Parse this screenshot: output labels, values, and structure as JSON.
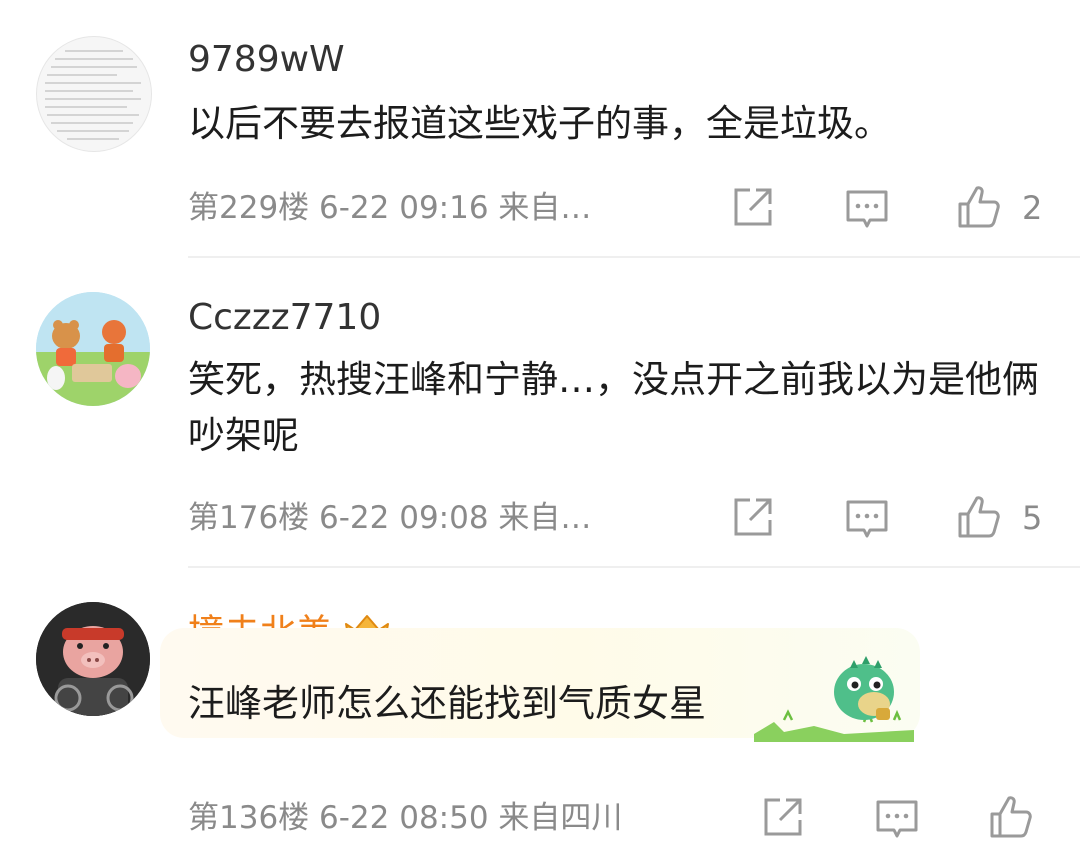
{
  "comments": [
    {
      "username": "9789wW",
      "text": "以后不要去报道这些戏子的事，全是垃圾。",
      "meta": "第229楼  6-22 09:16  来自…",
      "likes": "2"
    },
    {
      "username": "Cczzz7710",
      "text": "笑死，热搜汪峰和宁静…，没点开之前我以为是他俩吵架呢",
      "meta": "第176楼  6-22 09:08  来自…",
      "likes": "5"
    },
    {
      "username": "撞击北美",
      "username_color": "#f0801a",
      "text": "汪峰老师怎么还能找到气质女星",
      "meta": "第136楼  6-22 08:50  来自四川",
      "likes": ""
    }
  ],
  "colors": {
    "vip_name": "#f0801a",
    "meta_gray": "#8a8a8a",
    "icon_gray": "#9a9a9a"
  }
}
